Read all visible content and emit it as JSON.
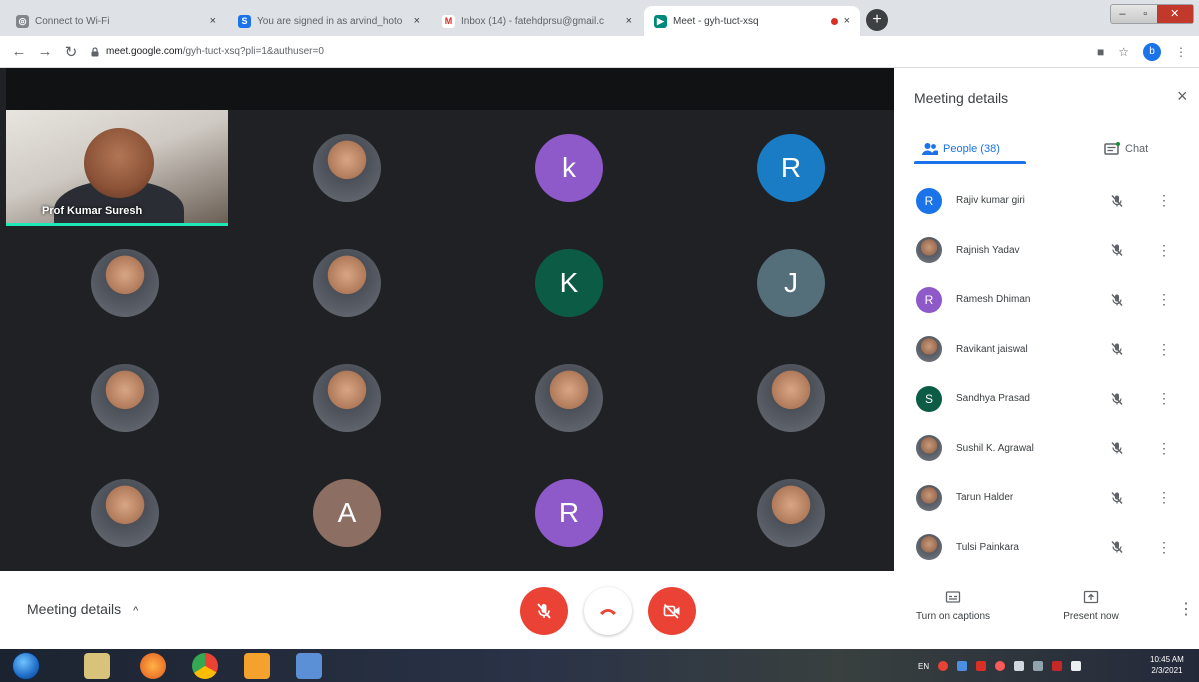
{
  "browser": {
    "tabs": [
      {
        "title": "Connect to Wi-Fi",
        "favicon_color": "#80868b",
        "active": false
      },
      {
        "title": "You are signed in as arvind_hoto",
        "favicon_color": "#1a73e8",
        "active": false
      },
      {
        "title": "Inbox (14) - fatehdprsu@gmail.c",
        "favicon_color": "#ffffff",
        "active": false
      },
      {
        "title": "Meet - gyh-tuct-xsq",
        "favicon_color": "#00897b",
        "active": true
      }
    ],
    "close_glyph": "×",
    "new_tab_glyph": "+",
    "url_host": "meet.google.com",
    "url_path": "/gyh-tuct-xsq?pli=1&authuser=0",
    "profile_initial": "b"
  },
  "stage": {
    "pinned_name": "Prof Kumar Suresh",
    "tiles": [
      {
        "type": "photo"
      },
      {
        "type": "letter",
        "letter": "k",
        "color": "#8e59c9"
      },
      {
        "type": "letter",
        "letter": "R",
        "color": "#1a7cc4"
      },
      {
        "type": "photo"
      },
      {
        "type": "photo"
      },
      {
        "type": "letter",
        "letter": "K",
        "color": "#0c5c45"
      },
      {
        "type": "letter",
        "letter": "J",
        "color": "#546e7a"
      },
      {
        "type": "photo"
      },
      {
        "type": "photo"
      },
      {
        "type": "photo"
      },
      {
        "type": "photo"
      },
      {
        "type": "photo"
      },
      {
        "type": "letter",
        "letter": "A",
        "color": "#8d6e63"
      },
      {
        "type": "letter",
        "letter": "R",
        "color": "#8e59c9"
      },
      {
        "type": "photo"
      },
      {
        "type": "photo"
      }
    ]
  },
  "panel": {
    "title": "Meeting details",
    "close_glyph": "×",
    "people_tab": "People (38)",
    "chat_tab": "Chat",
    "participants": [
      {
        "name": "Rajiv kumar giri",
        "initial": "R",
        "color": "#1a73e8",
        "photo": false
      },
      {
        "name": "Rajnish Yadav",
        "initial": "",
        "color": "",
        "photo": true
      },
      {
        "name": "Ramesh Dhiman",
        "initial": "R",
        "color": "#8e59c9",
        "photo": false
      },
      {
        "name": "Ravikant jaiswal",
        "initial": "",
        "color": "",
        "photo": true
      },
      {
        "name": "Sandhya Prasad",
        "initial": "S",
        "color": "#0c5c45",
        "photo": false
      },
      {
        "name": "Sushil K. Agrawal",
        "initial": "",
        "color": "",
        "photo": true
      },
      {
        "name": "Tarun Halder",
        "initial": "",
        "color": "",
        "photo": true
      },
      {
        "name": "Tulsi Painkara",
        "initial": "",
        "color": "",
        "photo": true
      }
    ],
    "more_glyph": "⋮"
  },
  "bottombar": {
    "meeting_details": "Meeting details",
    "chevron_glyph": "^",
    "captions_label": "Turn on captions",
    "present_label": "Present now",
    "more_glyph": "⋮"
  },
  "taskbar": {
    "clock_time": "10:45 AM",
    "clock_date": "2/3/2021",
    "lang": "EN"
  }
}
